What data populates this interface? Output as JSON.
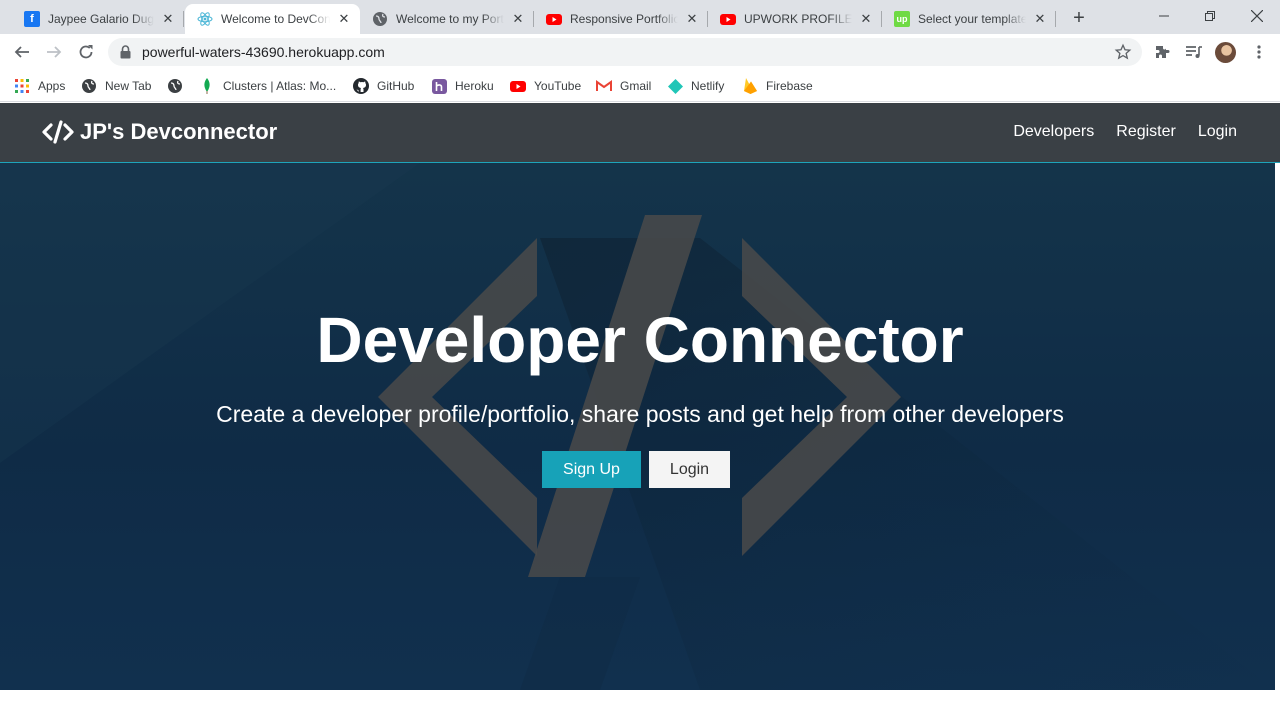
{
  "browser": {
    "tabs": [
      {
        "title": "Jaypee Galario Duga",
        "favicon": "facebook-icon",
        "color": "#1877f2"
      },
      {
        "title": "Welcome to DevCon",
        "favicon": "react-icon",
        "color": "#4bb6d6"
      },
      {
        "title": "Welcome to my Portf",
        "favicon": "globe-icon",
        "color": "#5f6368"
      },
      {
        "title": "Responsive Portfolio",
        "favicon": "youtube-icon",
        "color": "#ff0000"
      },
      {
        "title": "UPWORK PROFILE A",
        "favicon": "youtube-icon",
        "color": "#ff0000"
      },
      {
        "title": "Select your template",
        "favicon": "upwork-icon",
        "color": "#6fda44"
      }
    ],
    "new_tab_symbol": "+",
    "address": "powerful-waters-43690.herokuapp.com",
    "bookmarks": [
      {
        "label": "Apps",
        "icon": "apps-grid-icon"
      },
      {
        "label": "New Tab",
        "icon": "globe-icon"
      },
      {
        "label": "",
        "icon": "globe-icon"
      },
      {
        "label": "Clusters | Atlas: Mo...",
        "icon": "mongodb-leaf-icon"
      },
      {
        "label": "GitHub",
        "icon": "github-icon"
      },
      {
        "label": "Heroku",
        "icon": "heroku-icon"
      },
      {
        "label": "YouTube",
        "icon": "youtube-icon"
      },
      {
        "label": "Gmail",
        "icon": "gmail-icon"
      },
      {
        "label": "Netlify",
        "icon": "netlify-icon"
      },
      {
        "label": "Firebase",
        "icon": "firebase-icon"
      }
    ]
  },
  "site": {
    "brand": "JP's Devconnector",
    "nav": {
      "developers": "Developers",
      "register": "Register",
      "login": "Login"
    },
    "hero": {
      "title": "Developer Connector",
      "subtitle": "Create a developer profile/portfolio, share posts and get help from other developers",
      "signup": "Sign Up",
      "login": "Login"
    }
  },
  "colors": {
    "navbar": "#343a40",
    "accent": "#17a2b8",
    "hero_bg": "#12314b"
  }
}
